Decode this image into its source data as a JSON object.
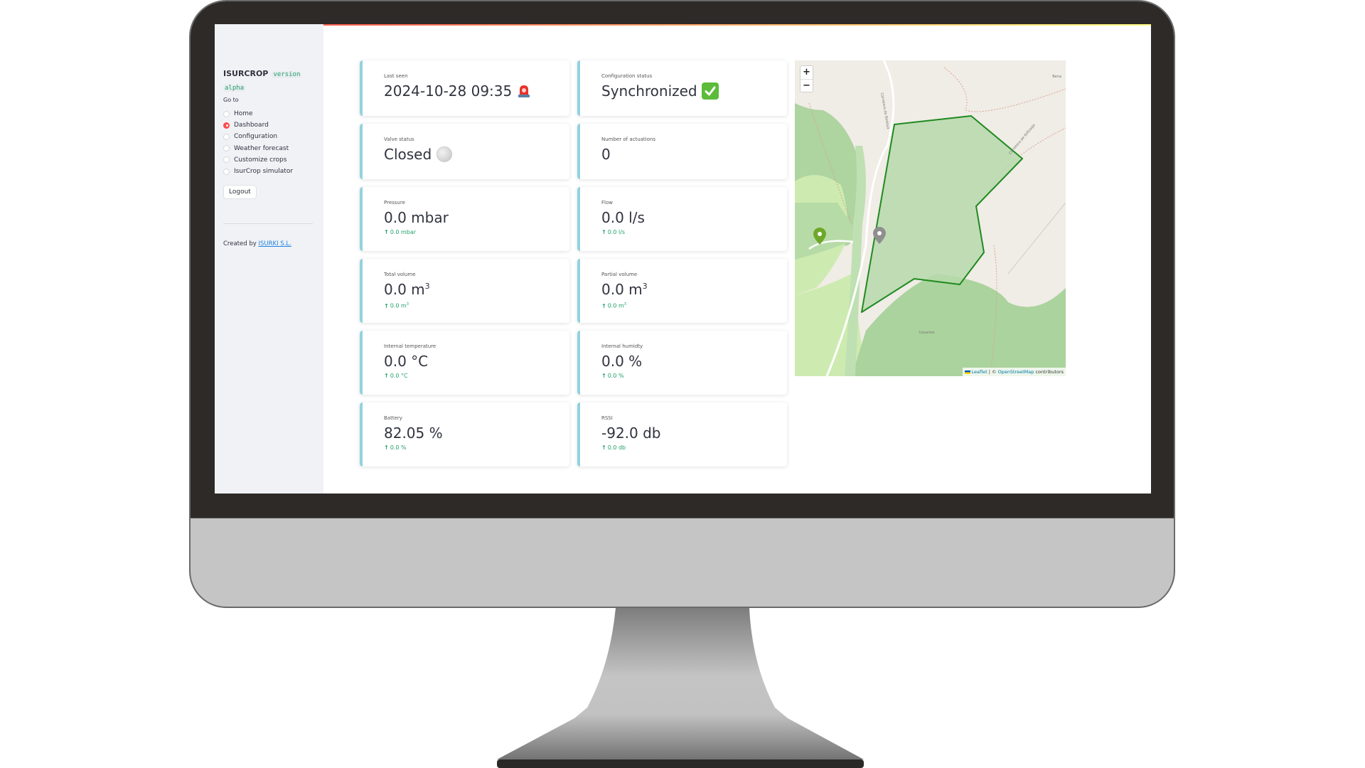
{
  "sidebar": {
    "app_name": "ISURCROP",
    "version_label": "version",
    "version_value": "alpha",
    "nav_heading": "Go to",
    "nav_items": [
      {
        "label": "Home",
        "selected": false
      },
      {
        "label": "Dashboard",
        "selected": true
      },
      {
        "label": "Configuration",
        "selected": false
      },
      {
        "label": "Weather forecast",
        "selected": false
      },
      {
        "label": "Customize crops",
        "selected": false
      },
      {
        "label": "IsurCrop simulator",
        "selected": false
      }
    ],
    "logout_label": "Logout",
    "created_by_prefix": "Created by",
    "created_by_link": "ISURKI S.L."
  },
  "metrics": {
    "last_seen": {
      "label": "Last seen",
      "value": "2024-10-28 09:35",
      "icon": "siren-icon"
    },
    "configuration_status": {
      "label": "Configuration status",
      "value": "Synchronized",
      "icon": "check-mark-icon"
    },
    "valve_status": {
      "label": "Valve status",
      "value": "Closed",
      "icon": "white-circle-icon"
    },
    "actuations": {
      "label": "Number of actuations",
      "value": "0"
    },
    "pressure": {
      "label": "Pressure",
      "value": "0.0 mbar",
      "delta": "0.0 mbar"
    },
    "flow": {
      "label": "Flow",
      "value": "0.0 l/s",
      "delta": "0.0 l/s"
    },
    "total_volume": {
      "label": "Total volume",
      "value": "0.0 m",
      "unit_sup": "3",
      "delta": "0.0 m",
      "delta_sup": "3"
    },
    "partial_volume": {
      "label": "Partial volume",
      "value": "0.0 m",
      "unit_sup": "3",
      "delta": "0.0 m",
      "delta_sup": "3"
    },
    "internal_temperature": {
      "label": "Internal temperature",
      "value": "0.0 °C",
      "delta": "0.0 °C"
    },
    "internal_humidity": {
      "label": "Internal humidty",
      "value": "0.0 %",
      "delta": "0.0 %"
    },
    "battery": {
      "label": "Battery",
      "value": "82.05 %",
      "delta": "0.0 %"
    },
    "rssi": {
      "label": "RSSI",
      "value": "-92.0 db",
      "delta": "0.0 db"
    }
  },
  "delta_arrow": "↑",
  "map": {
    "zoom_in": "+",
    "zoom_out": "−",
    "attribution_leaflet": "Leaflet",
    "attribution_sep": " | © ",
    "attribution_osm": "OpenStreetMap",
    "attribution_suffix": " contributors",
    "place_label": "Bena",
    "forest_label": "Usuarios",
    "road_label_1": "Carretera de Bedoya",
    "road_label_2": "Carretera de Ibiltzaga",
    "colors": {
      "polygon_stroke": "#1e8a1e",
      "polygon_fill": "#b6d9ac",
      "marker_green": "#6ea82a",
      "marker_grey": "#8f8f8f"
    }
  },
  "colors": {
    "accent": "#ff4b4b",
    "card_border": "#93d2e0",
    "delta_positive": "#21a06a"
  }
}
